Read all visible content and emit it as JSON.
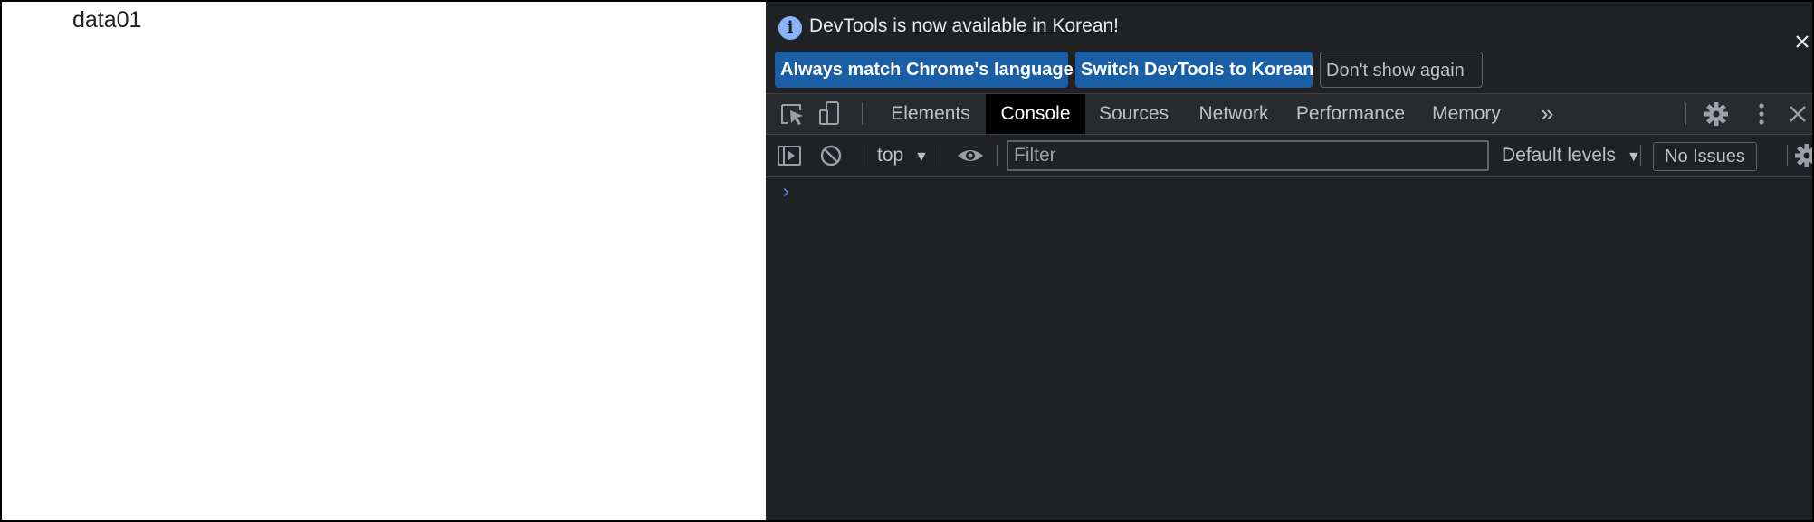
{
  "page": {
    "text": "data01"
  },
  "devtools": {
    "infobar": {
      "icon": "info-icon",
      "message": "DevTools is now available in Korean!",
      "buttons": [
        {
          "label": "Always match Chrome's language"
        },
        {
          "label": "Switch DevTools to Korean"
        },
        {
          "label": "Don't show again"
        }
      ],
      "close_icon": "close-icon"
    },
    "tabbar": {
      "left_icons": [
        "inspect-element-icon",
        "device-toolbar-icon"
      ],
      "tabs": [
        {
          "label": "Elements",
          "active": false
        },
        {
          "label": "Console",
          "active": true
        },
        {
          "label": "Sources",
          "active": false
        },
        {
          "label": "Network",
          "active": false
        },
        {
          "label": "Performance",
          "active": false
        },
        {
          "label": "Memory",
          "active": false
        }
      ],
      "more_tabs_glyph": "»",
      "right_icons": [
        "settings-gear-icon",
        "kebab-menu-icon",
        "close-icon"
      ]
    },
    "console_toolbar": {
      "context": "top",
      "filter_placeholder": "Filter",
      "levels": "Default levels",
      "issues": "No Issues"
    },
    "console": {
      "prompt_glyph": "›"
    }
  },
  "colors": {
    "devtools_bg": "#202124",
    "active_tab_bg": "#000000",
    "primary_button_bg": "#1a5fa5",
    "info_icon": "#8ab4f8",
    "prompt": "#4a90e2"
  }
}
